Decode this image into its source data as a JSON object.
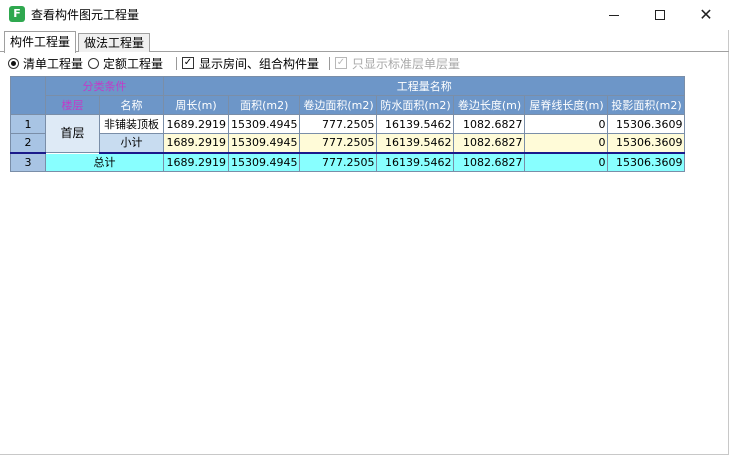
{
  "window": {
    "title": "查看构件图元工程量",
    "icon": "app-logo-icon",
    "controls": {
      "minimize": "minimize-icon",
      "maximize": "maximize-icon",
      "close": "close-icon"
    }
  },
  "tabs": [
    {
      "label": "构件工程量",
      "active": true
    },
    {
      "label": "做法工程量",
      "active": false
    }
  ],
  "options": {
    "radio_bill": "清单工程量",
    "radio_quota": "定额工程量",
    "check_show_room": "显示房间、组合构件量",
    "check_standard_floor": "只显示标准层单层量"
  },
  "table": {
    "group_classify": "分类条件",
    "group_quantity": "工程量名称",
    "col_floor": "楼层",
    "col_name": "名称",
    "columns": [
      "周长(m)",
      "面积(m2)",
      "卷边面积(m2)",
      "防水面积(m2)",
      "卷边长度(m)",
      "屋脊线长度(m)",
      "投影面积(m2)"
    ],
    "rows": [
      {
        "num": "1",
        "floor": "首层",
        "name": "非铺装顶板",
        "values": [
          "1689.2919",
          "15309.4945",
          "777.2505",
          "16139.5462",
          "1082.6827",
          "0",
          "15306.3609"
        ]
      },
      {
        "num": "2",
        "name": "小计",
        "values": [
          "1689.2919",
          "15309.4945",
          "777.2505",
          "16139.5462",
          "1082.6827",
          "0",
          "15306.3609"
        ]
      },
      {
        "num": "3",
        "name": "总计",
        "values": [
          "1689.2919",
          "15309.4945",
          "777.2505",
          "16139.5462",
          "1082.6827",
          "0",
          "15306.3609"
        ]
      }
    ]
  },
  "colors": {
    "header_bg": "#6d96c8",
    "total_row_bg": "#88ffff",
    "subtotal_row_bg": "#fffbd8",
    "classify_header_text": "#c03cc8"
  }
}
